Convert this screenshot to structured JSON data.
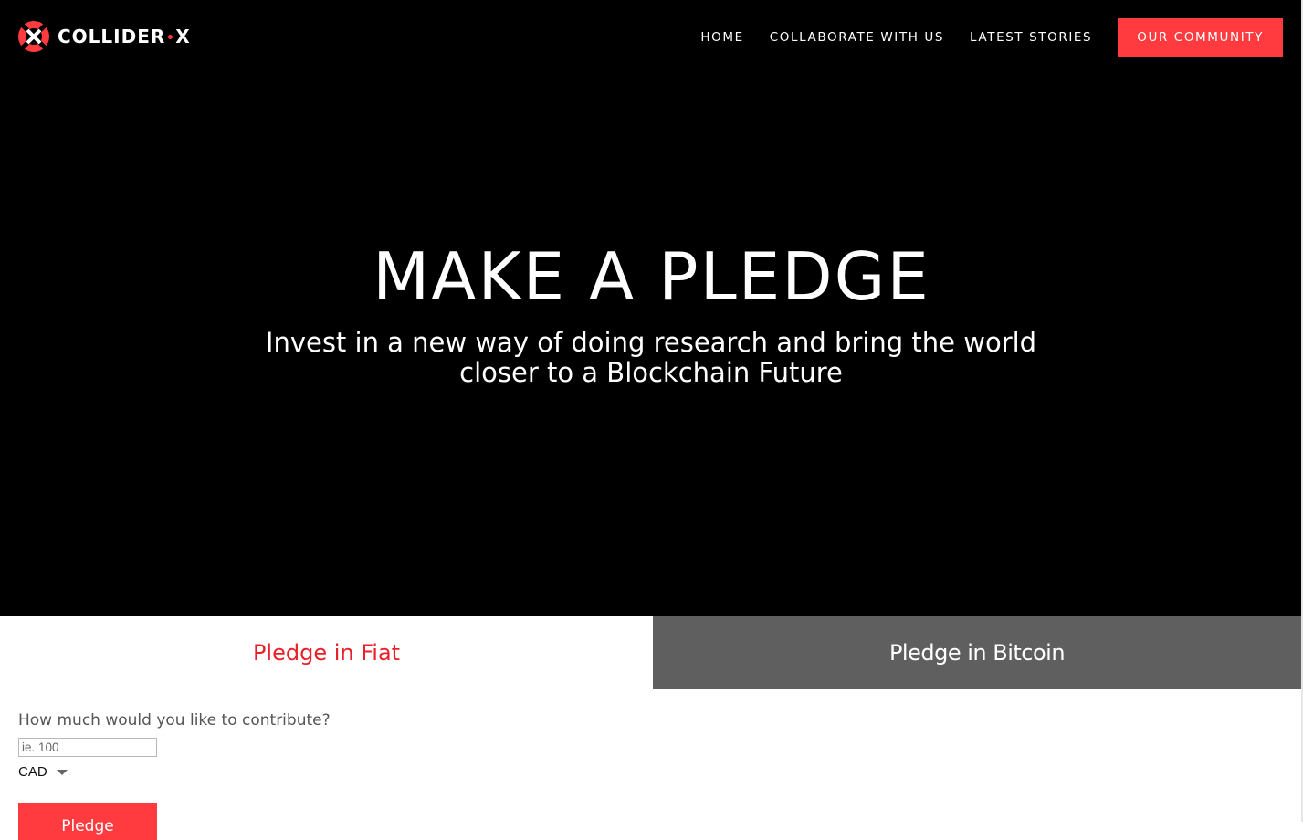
{
  "brand": {
    "name_part1": "COLLIDER",
    "name_part2": "X",
    "logo_icon": "collider-x-logo-icon",
    "accent_color": "#ff3b3f"
  },
  "nav": {
    "items": [
      {
        "label": "HOME"
      },
      {
        "label": "COLLABORATE WITH US"
      },
      {
        "label": "LATEST STORIES"
      }
    ],
    "cta_label": "OUR COMMUNITY"
  },
  "hero": {
    "title": "MAKE A PLEDGE",
    "subtitle": "Invest in a new way of doing research and bring the world closer to a Blockchain Future"
  },
  "tabs": {
    "fiat_label": "Pledge in Fiat",
    "bitcoin_label": "Pledge in Bitcoin",
    "active": "fiat",
    "active_color": "#e8202a",
    "inactive_bg": "#5f5f5f"
  },
  "form": {
    "contribution_label": "How much would you like to contribute?",
    "amount_placeholder": "ie. 100",
    "amount_value": "",
    "currency_selected": "CAD",
    "submit_label": "Pledge"
  }
}
